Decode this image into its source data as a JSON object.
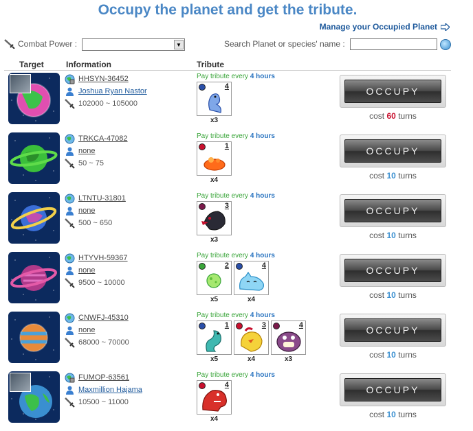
{
  "header": {
    "title": "Occupy the planet and get the tribute.",
    "manage_link": "Manage your Occupied Planet"
  },
  "filters": {
    "combat_power_label": "Combat Power :",
    "combat_power_value": "",
    "search_label": "Search Planet or species' name :",
    "search_value": ""
  },
  "table": {
    "headers": [
      "Target",
      "Information",
      "Tribute"
    ]
  },
  "colors": {
    "title": "#4a87c5",
    "tribute_text": "#3aa53a",
    "hours": "#2a74c0",
    "cost_high": "#c8102e",
    "cost_low": "#3a8fd0"
  },
  "rows": [
    {
      "planet_code": "HHSYN-36452",
      "owner": "Joshua Ryan Nastor",
      "power": "102000 ~ 105000",
      "pay_prefix": "Pay tribute every",
      "pay_hours": "4 hours",
      "tributes": [
        {
          "rank": "4",
          "qty": "x3",
          "dot_color": "#2a4fa8",
          "creature": "blue-dragon"
        }
      ],
      "button": "OCCUPY",
      "cost_prefix": "cost",
      "cost_value": "60",
      "cost_suffix": "turns",
      "planet_style": "pink-green",
      "has_avatar": true
    },
    {
      "planet_code": "TRKCA-47082",
      "owner": "none",
      "power": "50 ~ 75",
      "pay_prefix": "Pay tribute every",
      "pay_hours": "4 hours",
      "tributes": [
        {
          "rank": "1",
          "qty": "x4",
          "dot_color": "#c8102e",
          "creature": "orange-slime"
        }
      ],
      "button": "OCCUPY",
      "cost_prefix": "cost",
      "cost_value": "10",
      "cost_suffix": "turns",
      "planet_style": "green-ring",
      "has_avatar": false
    },
    {
      "planet_code": "LTNTU-31801",
      "owner": "none",
      "power": "500 ~ 650",
      "pay_prefix": "Pay tribute every",
      "pay_hours": "4 hours",
      "tributes": [
        {
          "rank": "3",
          "qty": "x3",
          "dot_color": "#7a1a4a",
          "creature": "dark-bird"
        }
      ],
      "button": "OCCUPY",
      "cost_prefix": "cost",
      "cost_value": "10",
      "cost_suffix": "turns",
      "planet_style": "blue-ring",
      "has_avatar": false
    },
    {
      "planet_code": "HTYVH-59367",
      "owner": "none",
      "power": "9500 ~ 10000",
      "pay_prefix": "Pay tribute every",
      "pay_hours": "4 hours",
      "tributes": [
        {
          "rank": "2",
          "qty": "x5",
          "dot_color": "#3aa53a",
          "creature": "green-orb"
        },
        {
          "rank": "4",
          "qty": "x4",
          "dot_color": "#2a4fa8",
          "creature": "blue-slime"
        }
      ],
      "button": "OCCUPY",
      "cost_prefix": "cost",
      "cost_value": "10",
      "cost_suffix": "turns",
      "planet_style": "pink-ring",
      "has_avatar": false
    },
    {
      "planet_code": "CNWFJ-45310",
      "owner": "none",
      "power": "68000 ~ 70000",
      "pay_prefix": "Pay tribute every",
      "pay_hours": "4 hours",
      "tributes": [
        {
          "rank": "1",
          "qty": "x5",
          "dot_color": "#2a4fa8",
          "creature": "teal-serpent"
        },
        {
          "rank": "3",
          "qty": "x4",
          "dot_color": "#c8102e",
          "creature": "yellow-bird"
        },
        {
          "rank": "4",
          "qty": "x3",
          "dot_color": "#7a1a4a",
          "creature": "purple-monster"
        }
      ],
      "button": "OCCUPY",
      "cost_prefix": "cost",
      "cost_value": "10",
      "cost_suffix": "turns",
      "planet_style": "orange-blue",
      "has_avatar": false
    },
    {
      "planet_code": "FUMOP-63561",
      "owner": "Maxmillion Hajama",
      "power": "10500 ~ 11000",
      "pay_prefix": "Pay tribute every",
      "pay_hours": "4 hours",
      "tributes": [
        {
          "rank": "4",
          "qty": "x4",
          "dot_color": "#c8102e",
          "creature": "red-dino"
        }
      ],
      "button": "OCCUPY",
      "cost_prefix": "cost",
      "cost_value": "10",
      "cost_suffix": "turns",
      "planet_style": "earth",
      "has_avatar": true
    }
  ]
}
